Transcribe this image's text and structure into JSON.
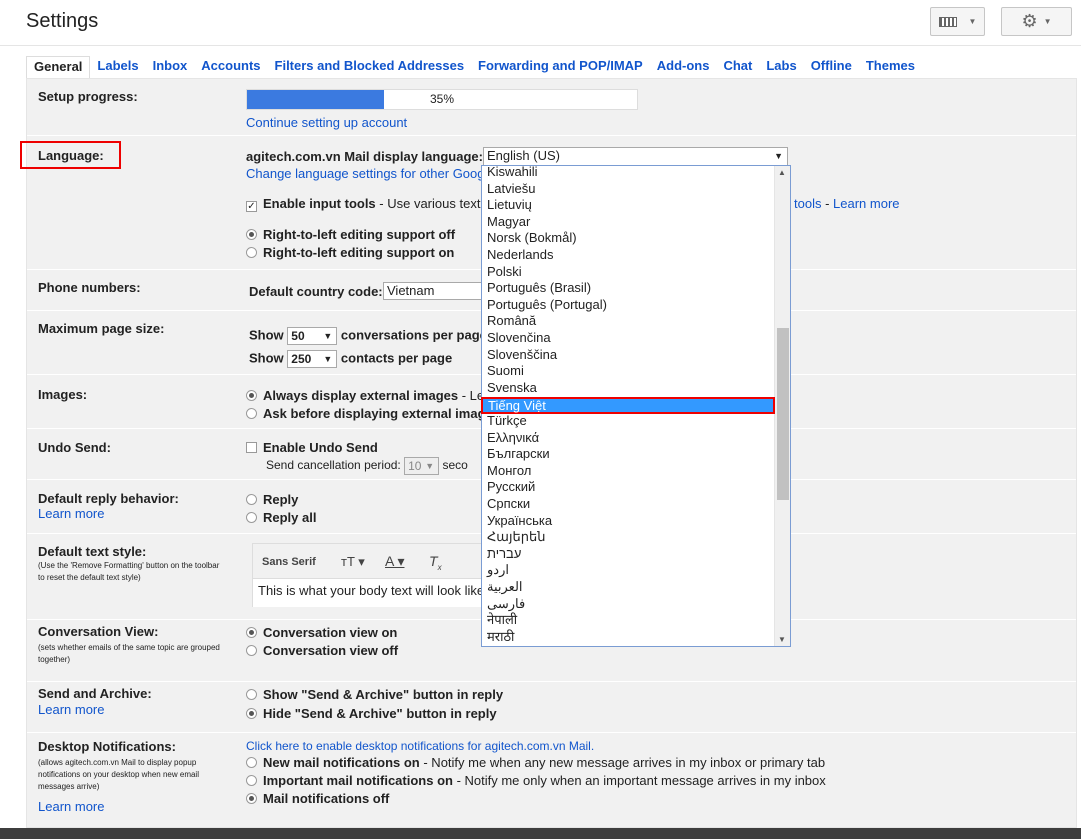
{
  "title": "Settings",
  "tabs": [
    "General",
    "Labels",
    "Inbox",
    "Accounts",
    "Filters and Blocked Addresses",
    "Forwarding and POP/IMAP",
    "Add-ons",
    "Chat",
    "Labs",
    "Offline",
    "Themes"
  ],
  "setup": {
    "label": "Setup progress:",
    "percent": "35%",
    "progress": 0.35,
    "link": "Continue setting up account"
  },
  "language": {
    "label": "Language:",
    "display_label": "agitech.com.vn Mail display language:",
    "selected": "English (US)",
    "change_link": "Change language settings for other Googl",
    "enable_input": "Enable input tools",
    "enable_input_desc": " - Use various text",
    "tools_tail": "tools",
    "learn_more": "Learn more",
    "rtl_off": "Right-to-left editing support off",
    "rtl_on": "Right-to-left editing support on"
  },
  "phone": {
    "label": "Phone numbers:",
    "country_label": "Default country code:",
    "country": "Vietnam"
  },
  "pagesize": {
    "label": "Maximum page size:",
    "show": "Show",
    "conv_val": "50",
    "conv_text": "conversations per page",
    "contacts_val": "250",
    "contacts_text": "contacts per page"
  },
  "images": {
    "label": "Images:",
    "always": "Always display external images",
    "always_tail": " - Le",
    "ask": "Ask before displaying external imag"
  },
  "undo": {
    "label": "Undo Send:",
    "enable": "Enable Undo Send",
    "period_label": "Send cancellation period:",
    "period": "10",
    "period_tail": "seco"
  },
  "reply": {
    "label": "Default reply behavior:",
    "learn": "Learn more",
    "reply": "Reply",
    "reply_all": "Reply all"
  },
  "textstyle": {
    "label": "Default text style:",
    "desc": "(Use the 'Remove Formatting' button on the toolbar to reset the default text style)",
    "font": "Sans Serif",
    "sample": "This is what your body text will look like"
  },
  "conversation": {
    "label": "Conversation View:",
    "desc": "(sets whether emails of the same topic are grouped together)",
    "on": "Conversation view on",
    "off": "Conversation view off"
  },
  "sendarchive": {
    "label": "Send and Archive:",
    "learn": "Learn more",
    "show": "Show \"Send & Archive\" button in reply",
    "hide": "Hide \"Send & Archive\" button in reply"
  },
  "desktop": {
    "label": "Desktop Notifications:",
    "desc": "(allows agitech.com.vn Mail to display popup notifications on your desktop when new email messages arrive)",
    "learn": "Learn more",
    "enable_link": "Click here to enable desktop notifications for agitech.com.vn Mail.",
    "new_mail": "New mail notifications on",
    "new_mail_desc": " - Notify me when any new message arrives in my inbox or primary tab",
    "important": "Important mail notifications on",
    "important_desc": " - Notify me only when an important message arrives in my inbox",
    "off": "Mail notifications off"
  },
  "languages": [
    "Kiswahili",
    "Latviešu",
    "Lietuvių",
    "Magyar",
    "Norsk (Bokmål)",
    "Nederlands",
    "Polski",
    "Português (Brasil)",
    "Português (Portugal)",
    "Română",
    "Slovenčina",
    "Slovenščina",
    "Suomi",
    "Svenska",
    "Tiếng Việt",
    "Türkçe",
    "Ελληνικά",
    "Български",
    "Монгол",
    "Русский",
    "Српски",
    "Українська",
    "Հայերեն",
    "עברית",
    "اردو",
    "العربية",
    "فارسی",
    "नेपाली",
    "मराठी"
  ],
  "highlighted_language": "Tiếng Việt"
}
